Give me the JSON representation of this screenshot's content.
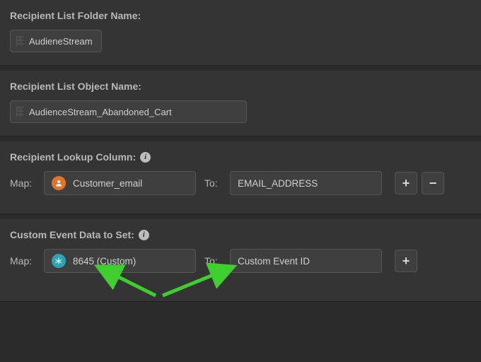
{
  "folder": {
    "label": "Recipient List Folder Name:",
    "chip": "AudieneStream"
  },
  "object": {
    "label": "Recipient List Object Name:",
    "chip": "AudienceStream_Abandoned_Cart"
  },
  "lookup": {
    "label": "Recipient Lookup Column:",
    "map_label": "Map:",
    "to_label": "To:",
    "source_icon": "user-icon",
    "source_value": "Customer_email",
    "target_value": "EMAIL_ADDRESS",
    "add": "+",
    "remove": "−"
  },
  "custom": {
    "label": "Custom Event Data to Set:",
    "map_label": "Map:",
    "to_label": "To:",
    "source_icon": "asterisk-icon",
    "source_value": "8645 (Custom)",
    "target_value": "Custom Event ID",
    "add": "+"
  }
}
